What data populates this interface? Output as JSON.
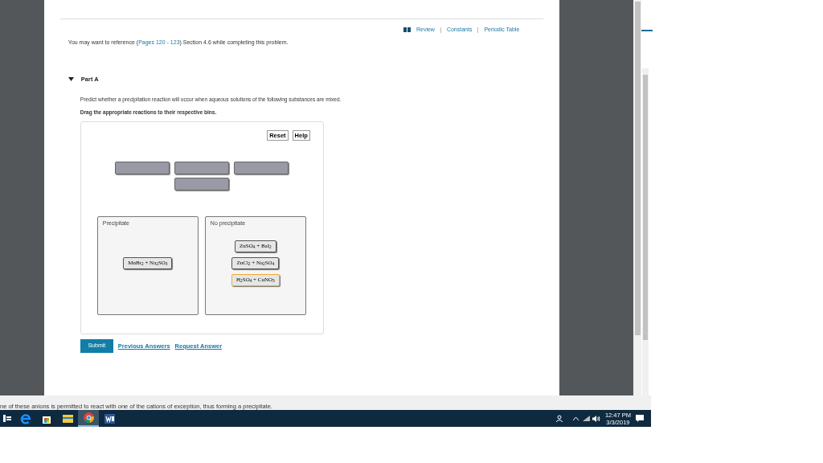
{
  "header_links": [
    "Review",
    "Constants",
    "Periodic Table"
  ],
  "reference": {
    "before": "You may want to reference (",
    "link": "Pages 120 - 123",
    "after": ") Section 4.6 while completing this problem."
  },
  "part": {
    "title": "Part A",
    "expanded": true
  },
  "prompt": "Predict whether a precipitation reaction will occur when aqueous solutions of the following substances are mixed.",
  "instruction": "Drag the appropriate reactions to their respective bins.",
  "tool_buttons": [
    "Reset",
    "Help"
  ],
  "bins": [
    {
      "label": "Precipitate",
      "items": [
        {
          "text": "MnBr$_{2}$ + Na$_{2}$SO$_{3}$",
          "selected": false
        }
      ]
    },
    {
      "label": "No precipitate",
      "items": [
        {
          "text": "ZnSO$_{4}$ + BaI$_{2}$",
          "selected": false
        },
        {
          "text": "ZnCl$_{2}$ + Na$_{2}$SO$_{4}$",
          "selected": false
        },
        {
          "text": "H$_{2}$SO$_{4}$ + CuNO$_{3}$",
          "selected": true
        }
      ]
    }
  ],
  "submit": "Submit",
  "answer_links": [
    "Previous Answers",
    "Request Answer"
  ],
  "background_text": "ne of these anions is permitted to react with one of the cations of exception, thus forming a precipitate.",
  "taskbar": {
    "apps": [
      {
        "kind": "edge",
        "selected": false
      },
      {
        "kind": "store",
        "selected": false
      },
      {
        "kind": "folder",
        "selected": false
      },
      {
        "kind": "chrome",
        "selected": true
      },
      {
        "kind": "word",
        "selected": false
      }
    ],
    "time": "12:47 PM",
    "date": "3/3/2019"
  }
}
